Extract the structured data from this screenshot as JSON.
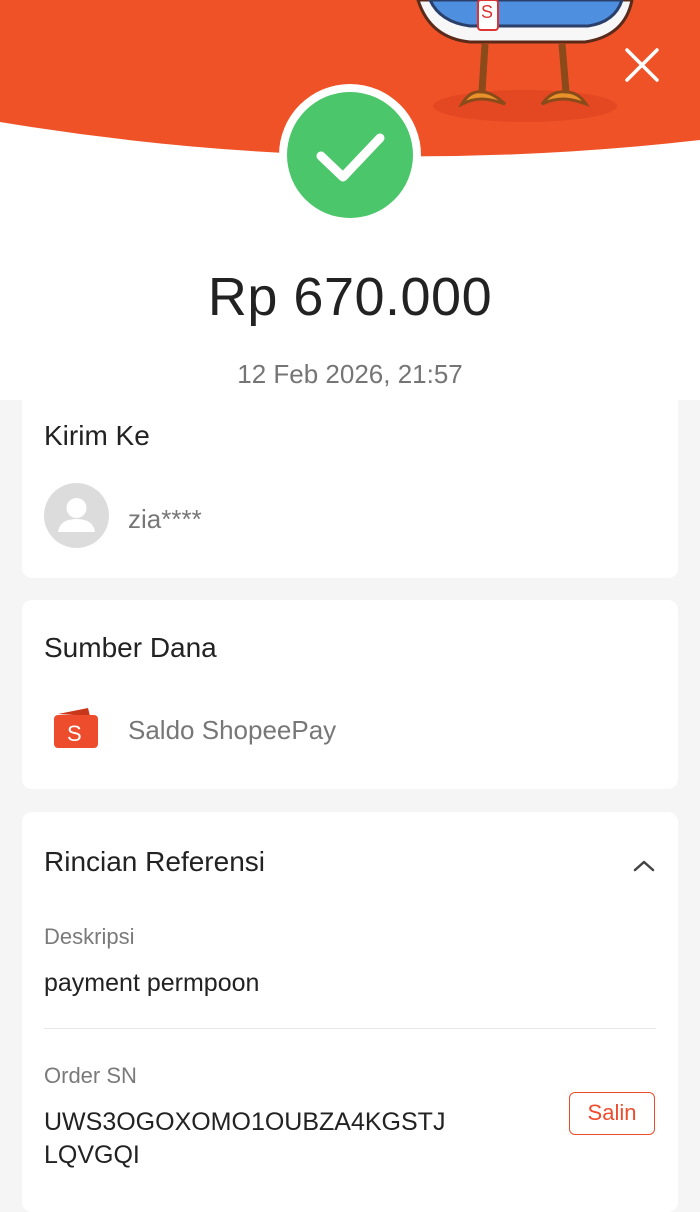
{
  "header": {
    "close_icon": "close-icon",
    "success_icon": "checkmark-icon",
    "brand_color": "#ee4d2d",
    "success_color": "#4cc66a",
    "mascot_badge": "S"
  },
  "transaction": {
    "amount": "Rp 670.000",
    "datetime": "12 Feb 2026, 21:57"
  },
  "recipient": {
    "title": "Kirim Ke",
    "name": "zia****",
    "avatar_icon": "user-avatar-icon"
  },
  "source": {
    "title": "Sumber Dana",
    "method": "Saldo ShopeePay",
    "wallet_icon": "shopeepay-wallet-icon"
  },
  "reference": {
    "title": "Rincian Referensi",
    "toggle_icon": "chevron-up-icon",
    "description_label": "Deskripsi",
    "description_value": "payment permpoon",
    "order_label": "Order SN",
    "order_value_line1": "UWS3OGOXOMO1OUBZA4KGSTJ",
    "order_value_line2": "LQVGQI",
    "copy_label": "Salin"
  }
}
